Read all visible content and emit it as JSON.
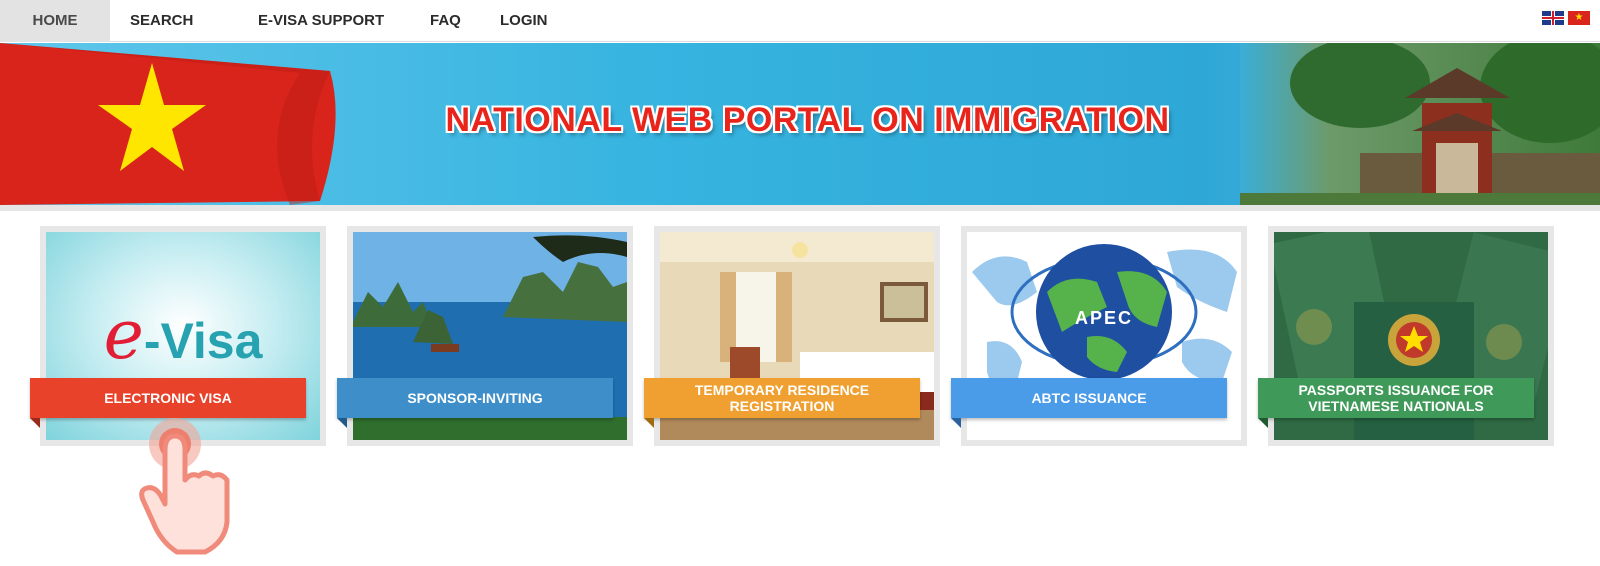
{
  "nav": {
    "items": [
      {
        "label": "HOME",
        "active": true
      },
      {
        "label": "SEARCH"
      },
      {
        "label": "E-VISA SUPPORT"
      },
      {
        "label": "FAQ"
      },
      {
        "label": "LOGIN"
      }
    ],
    "languages": [
      "English",
      "Vietnamese"
    ]
  },
  "banner": {
    "title": "NATIONAL WEB PORTAL ON IMMIGRATION"
  },
  "tiles": [
    {
      "label": "ELECTRONIC VISA",
      "color": "#e8432a",
      "image_text_e": "e",
      "image_text_rest": "-Visa"
    },
    {
      "label": "SPONSOR-INVITING",
      "color": "#3e8fc9"
    },
    {
      "label": "TEMPORARY RESIDENCE REGISTRATION",
      "color": "#f0a030"
    },
    {
      "label": "ABTC ISSUANCE",
      "color": "#4a9be8",
      "image_text": "APEC"
    },
    {
      "label": "PASSPORTS ISSUANCE FOR VIETNAMESE NATIONALS",
      "color": "#3f9a5a"
    }
  ],
  "colors": {
    "accent_red": "#e8241b",
    "nav_active_bg": "#e3e3e3",
    "hand_pointer": "#f08a7a"
  },
  "icons": [
    "uk-flag-icon",
    "vn-flag-icon",
    "hand-pointer-icon"
  ]
}
